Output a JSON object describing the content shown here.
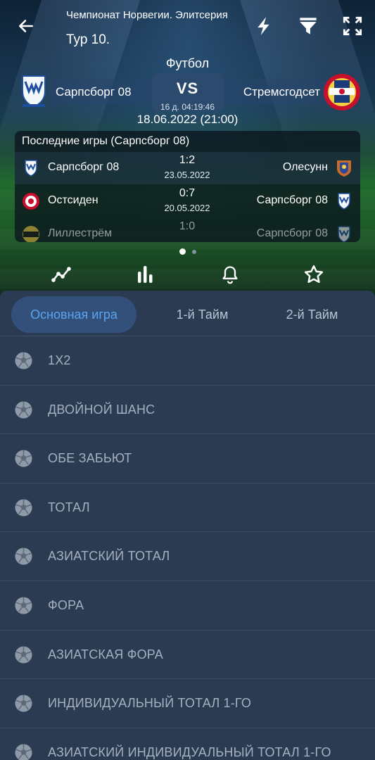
{
  "header": {
    "league": "Чемпионат Норвегии. Элитсерия",
    "round": "Тур 10.",
    "sport": "Футбол",
    "home_team": "Сарпсборг 08",
    "away_team": "Стремсгодсет",
    "vs": "VS",
    "countdown": "16 д. 04:19:46",
    "kickoff": "18.06.2022 (21:00)"
  },
  "last_games": {
    "title": "Последние игры (Сарпсборг 08)",
    "rows": [
      {
        "home": "Сарпсборг 08",
        "score": "1:2",
        "date": "23.05.2022",
        "away": "Олесунн"
      },
      {
        "home": "Остсиден",
        "score": "0:7",
        "date": "20.05.2022",
        "away": "Сарпсборг 08"
      },
      {
        "home": "Лиллестрём",
        "score": "1:0",
        "date": "",
        "away": "Сарпсборг 08"
      }
    ]
  },
  "pager": {
    "current": 1,
    "total": 2
  },
  "tabs": [
    "Основная игра",
    "1-й Тайм",
    "2-й Тайм"
  ],
  "markets": [
    "1X2",
    "ДВОЙНОЙ ШАНС",
    "ОБЕ ЗАБЬЮТ",
    "ТОТАЛ",
    "АЗИАТСКИЙ ТОТАЛ",
    "ФОРА",
    "АЗИАТСКАЯ ФОРА",
    "ИНДИВИДУАЛЬНЫЙ ТОТАЛ 1-ГО",
    "АЗИАТСКИЙ ИНДИВИДУАЛЬНЫЙ ТОТАЛ 1-ГО"
  ],
  "icons": {
    "back": "arrow-left-icon",
    "flash": "lightning-icon",
    "filter": "filter-icon",
    "fullscreen": "expand-icon",
    "stats_line": "line-chart-icon",
    "stats_bars": "bar-chart-icon",
    "notify": "bell-icon",
    "favorite": "star-icon",
    "market": "soccer-ball-icon"
  },
  "colors": {
    "sheet_bg": "#2a3b52",
    "active_tab_bg": "#33507a",
    "active_tab_text": "#5aa4ee",
    "market_text": "#a5b1bf"
  }
}
